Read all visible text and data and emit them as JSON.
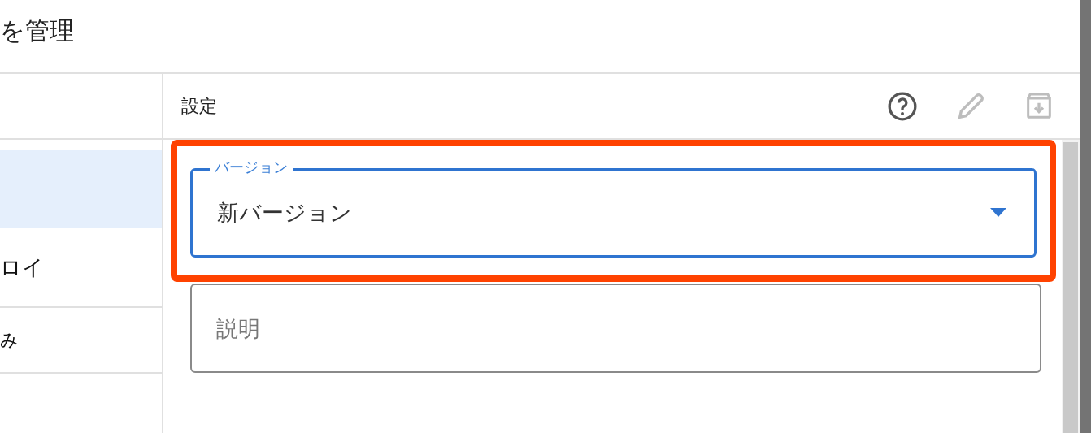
{
  "window": {
    "title": "を管理"
  },
  "sidebar": {
    "items": [
      {
        "selected": true
      },
      {
        "label": "ロイ",
        "selected": false
      },
      {
        "label": "み",
        "selected": false
      }
    ]
  },
  "panel": {
    "title": "設定",
    "actions": [
      {
        "kind": "help",
        "disabled": false
      },
      {
        "kind": "edit",
        "disabled": true
      },
      {
        "kind": "archive",
        "disabled": true
      }
    ],
    "fields": [
      {
        "kind": "select",
        "label": "バージョン",
        "value": "新バージョン",
        "focused": true,
        "highlighted": true
      },
      {
        "kind": "text",
        "placeholder": "説明",
        "focused": false,
        "highlighted": false
      }
    ]
  }
}
